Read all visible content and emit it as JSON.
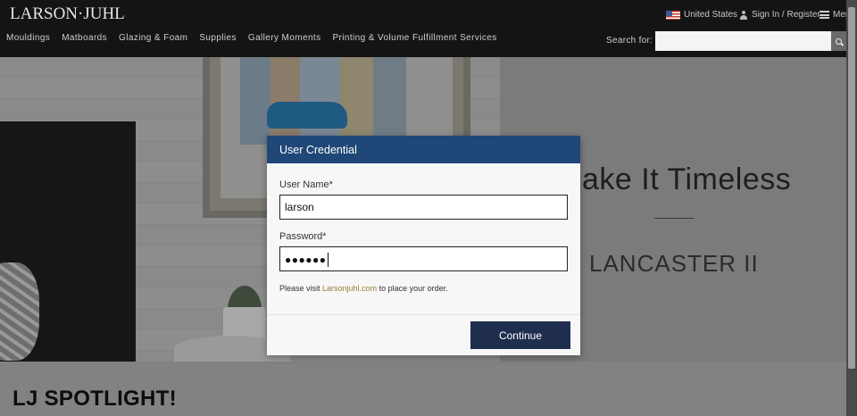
{
  "header": {
    "logo": "LARSON·JUHL",
    "country": "United States",
    "sign_in": "Sign In / Register",
    "menu": "Menu",
    "nav": [
      "Mouldings",
      "Matboards",
      "Glazing & Foam",
      "Supplies",
      "Gallery Moments",
      "Printing & Volume Fulfillment Services"
    ],
    "search_label": "Search for:",
    "search_value": ""
  },
  "hero": {
    "title": "ake It Timeless",
    "subtitle": "LANCASTER II"
  },
  "spotlight": {
    "title": "LJ SPOTLIGHT!"
  },
  "modal": {
    "title": "User Credential",
    "username_label": "User Name*",
    "username_value": "larson",
    "password_label": "Password*",
    "password_mask": "●●●●●●",
    "notice_prefix": "Please visit ",
    "notice_link": "Larsonjuhl.com",
    "notice_suffix": " to place your order.",
    "continue_label": "Continue"
  },
  "colors": {
    "modal_header": "#1f4777",
    "button": "#1f2e4e",
    "link": "#9a7d35",
    "topbar": "#141414"
  },
  "icons": [
    "us-flag-icon",
    "user-icon",
    "hamburger-icon",
    "search-icon"
  ]
}
